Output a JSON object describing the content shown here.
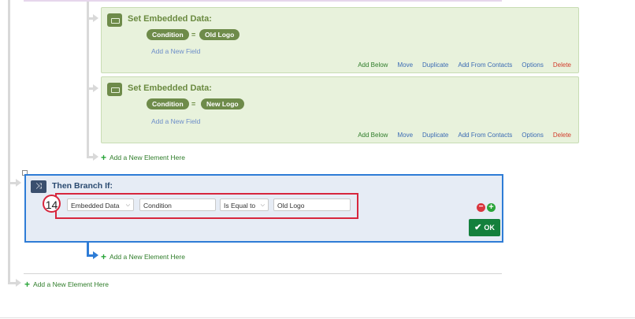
{
  "embedded_blocks": [
    {
      "title": "Set Embedded Data:",
      "field": "Condition",
      "operator": "=",
      "value": "Old Logo",
      "add_field": "Add a New Field",
      "actions": [
        "Add Below",
        "Move",
        "Duplicate",
        "Add From Contacts",
        "Options",
        "Delete"
      ]
    },
    {
      "title": "Set Embedded Data:",
      "field": "Condition",
      "operator": "=",
      "value": "New Logo",
      "add_field": "Add a New Field",
      "actions": [
        "Add Below",
        "Move",
        "Duplicate",
        "Add From Contacts",
        "Options",
        "Delete"
      ]
    }
  ],
  "add_element": "Add a New Element Here",
  "branch": {
    "title": "Then Branch If:",
    "step_number": "14",
    "source": "Embedded Data",
    "field": "Condition",
    "operator": "Is Equal to",
    "value": "Old Logo",
    "ok_label": "OK"
  },
  "colors": {
    "green_block": "#e8f2dc",
    "branch_block": "#e6ecf5",
    "branch_border": "#2e7cd6",
    "highlight": "#d7263d",
    "ok_button": "#14803c"
  }
}
